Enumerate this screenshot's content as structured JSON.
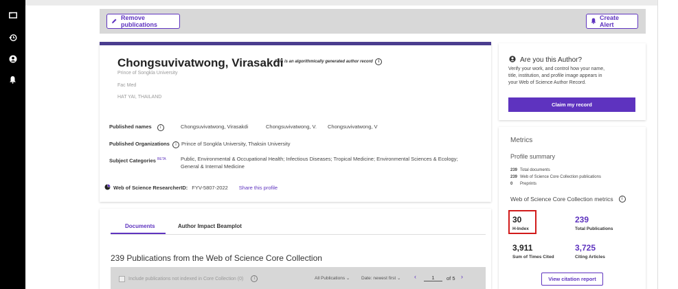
{
  "sidebar": {
    "icons": [
      "folder-icon",
      "history-icon",
      "user-icon",
      "bell-icon"
    ]
  },
  "topbar": {
    "remove_label": "Remove publications",
    "alert_label": "Create Alert"
  },
  "author": {
    "name": "Chongsuvivatwong, Virasakdi",
    "algo_note": "This is an algorithmically generated author record",
    "institution": "Prince of Songkla University",
    "department": "Fac Med",
    "location": "HAT YAI, THAILAND"
  },
  "details": {
    "published_names_label": "Published names",
    "published_names": [
      "Chongsuvivatwong, Virasakdi",
      "Chongsuvivatwong, V.",
      "Chongsuvivatwong, V"
    ],
    "orgs_label": "Published Organizations",
    "orgs_value": "Prince of Songkla University,  Thaksin University",
    "subject_label": "Subject Categories",
    "beta": "BETA",
    "subject_line1": "Public, Environmental & Occupational Health;  Infectious Diseases;  Tropical Medicine;  Environmental Sciences & Ecology;",
    "subject_line2": "General & Internal Medicine",
    "researcher_label": "Web of Science ResearcherID:",
    "researcher_id": "FYV-5807-2022",
    "share_label": "Share this profile"
  },
  "tabs": {
    "documents": "Documents",
    "beamplot": "Author Impact Beamplot"
  },
  "publications": {
    "heading": "239 Publications from the Web of Science Core Collection",
    "include_label": "Include publications not indexed in Core Collection (0)",
    "filter": "All Publications",
    "sort": "Date: newest first",
    "page": "1",
    "of_pages": "of 5"
  },
  "claim": {
    "title": "Are you this Author?",
    "text_line1": "Verify your work, and control how your name,",
    "text_line2": "title, institution, and profile image appears in",
    "text_line3": "your Web of Science Author Record.",
    "button": "Claim my record"
  },
  "metrics": {
    "title": "Metrics",
    "profile_summary": "Profile summary",
    "summary": [
      {
        "num": "239",
        "label": "Total documents"
      },
      {
        "num": "239",
        "label": "Web of Science Core Collection publications"
      },
      {
        "num": "0",
        "label": "Preprints"
      }
    ],
    "core_title": "Web of Science Core Collection metrics",
    "h_index": "30",
    "h_index_label": "H-Index",
    "total_pubs": "239",
    "total_pubs_label": "Total Publications",
    "times_cited": "3,911",
    "times_cited_label": "Sum of Times Cited",
    "citing": "3,725",
    "citing_label": "Citing Articles",
    "report_button": "View citation report"
  },
  "colors": {
    "accent": "#5e33bf",
    "highlight": "#d11a1a",
    "link": "#5e33bf"
  }
}
